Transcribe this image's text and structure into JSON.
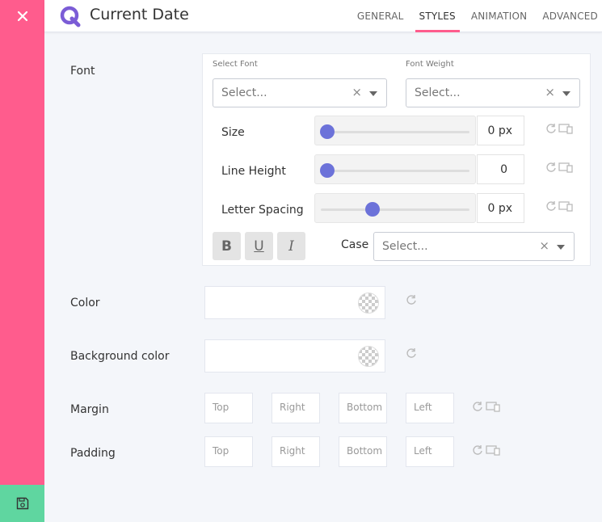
{
  "header": {
    "title": "Current Date",
    "tabs": [
      {
        "label": "GENERAL",
        "active": false
      },
      {
        "label": "STYLES",
        "active": true
      },
      {
        "label": "ANIMATION",
        "active": false
      },
      {
        "label": "ADVANCED",
        "active": false
      }
    ]
  },
  "rail": {
    "close_icon": "close-icon",
    "save_icon": "save-icon"
  },
  "colors": {
    "rail": "#ff5c8d",
    "save": "#5fd6a0",
    "accent": "#6c72d9",
    "active_tab": "#ff5c8d"
  },
  "font": {
    "label": "Font",
    "select_font": {
      "label": "Select Font",
      "placeholder": "Select..."
    },
    "font_weight": {
      "label": "Font Weight",
      "placeholder": "Select..."
    },
    "size": {
      "label": "Size",
      "value": "0 px",
      "level": 0.0
    },
    "line_height": {
      "label": "Line Height",
      "value": "0",
      "level": 0.0
    },
    "letter_spacing": {
      "label": "Letter Spacing",
      "value": "0 px",
      "level": 0.34
    },
    "styles": {
      "bold": "B",
      "underline": "U",
      "italic": "I"
    },
    "case": {
      "label": "Case",
      "placeholder": "Select..."
    }
  },
  "color": {
    "label": "Color"
  },
  "background_color": {
    "label": "Background color"
  },
  "margin": {
    "label": "Margin",
    "placeholders": [
      "Top",
      "Right",
      "Bottom",
      "Left"
    ]
  },
  "padding": {
    "label": "Padding",
    "placeholders": [
      "Top",
      "Right",
      "Bottom",
      "Left"
    ]
  }
}
